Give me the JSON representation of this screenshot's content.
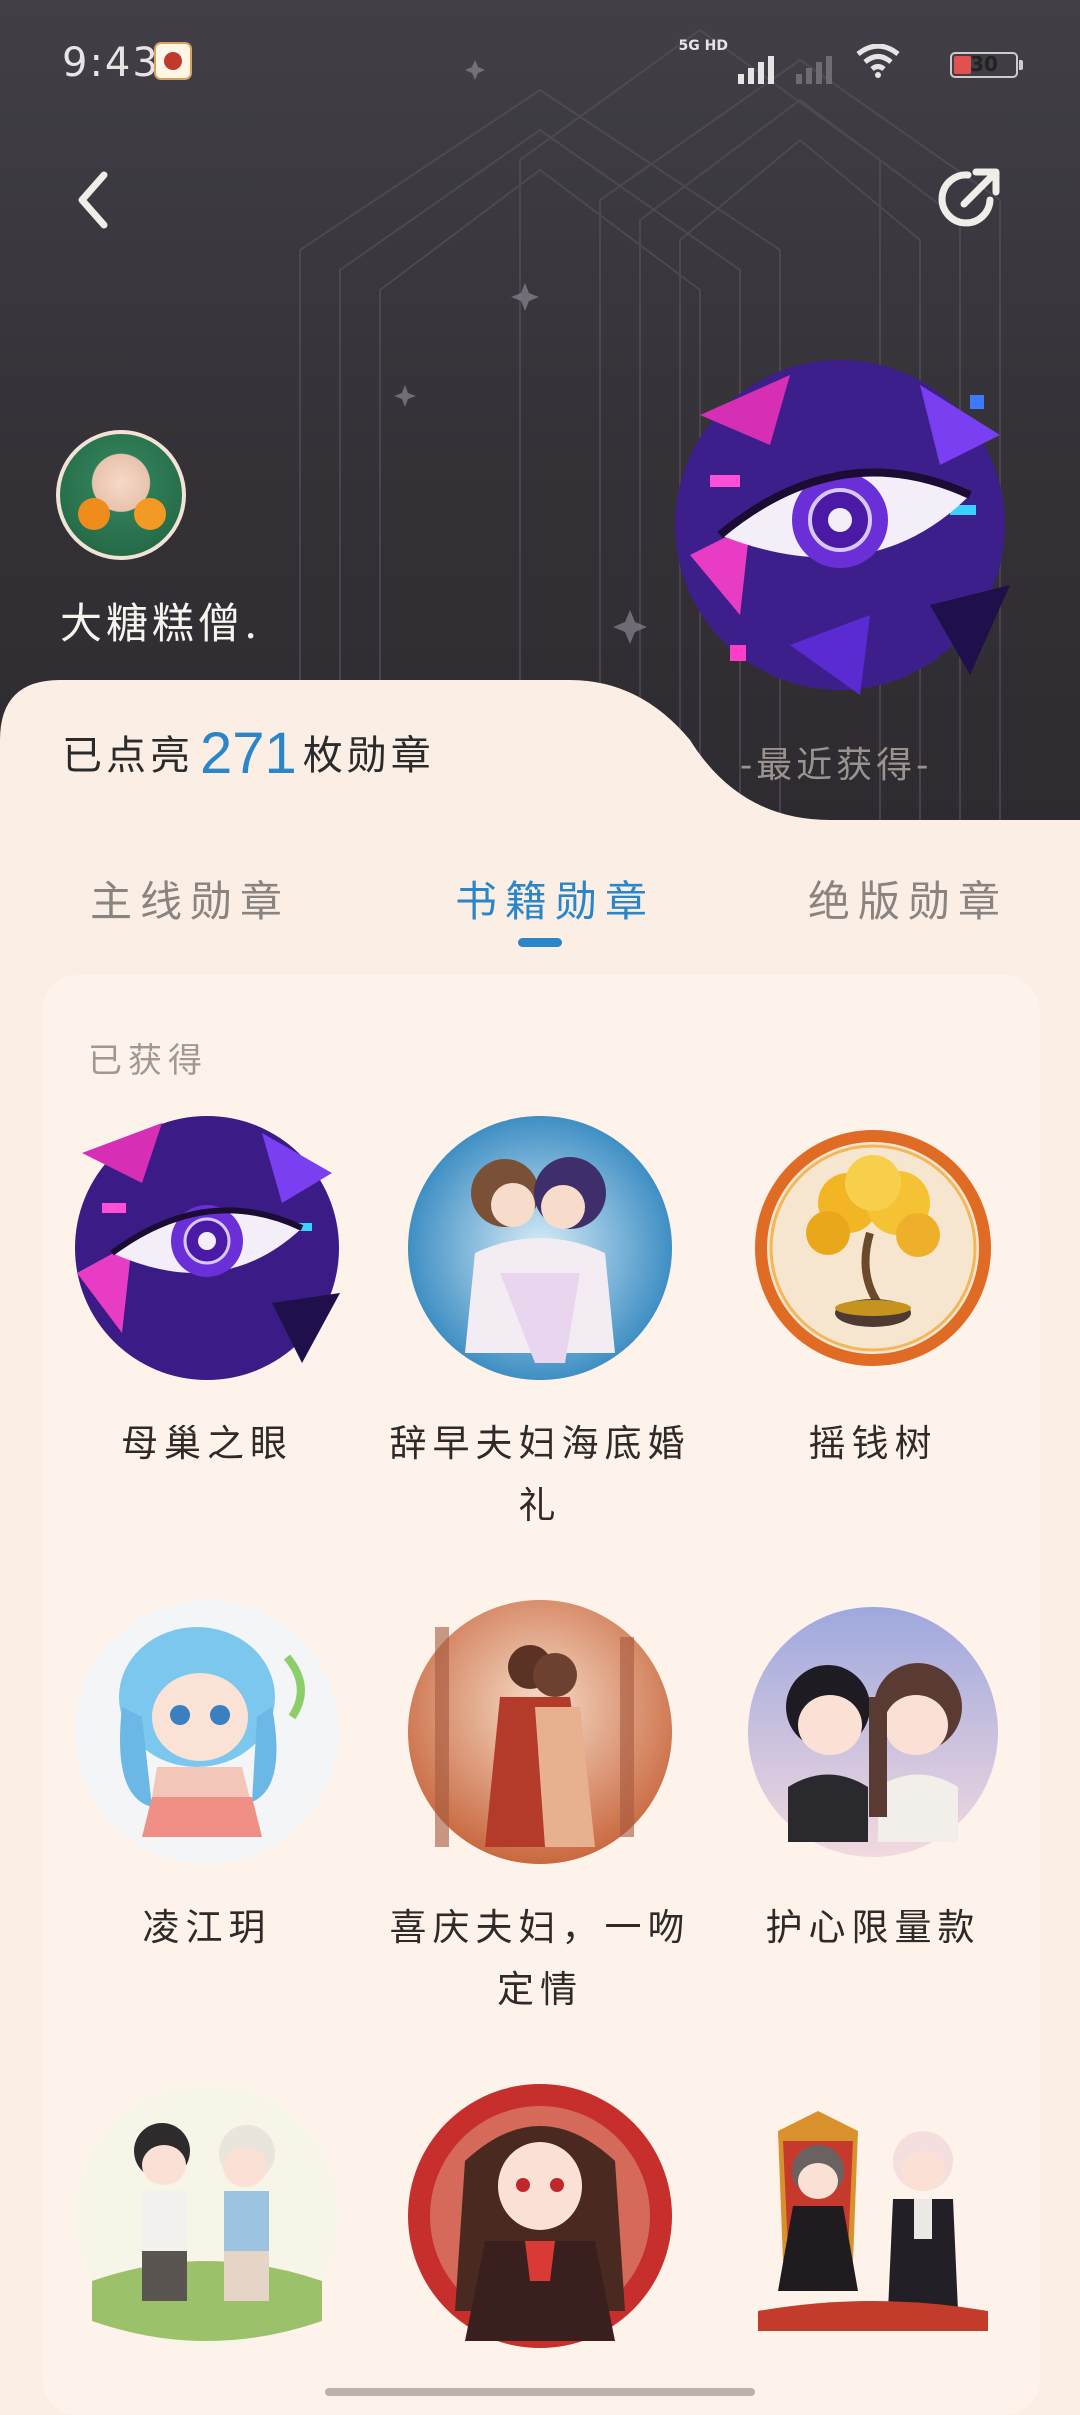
{
  "status_bar": {
    "time": "9:43",
    "network": "5G HD",
    "battery": "30"
  },
  "header": {
    "username": "大糖糕僧.",
    "recent_label": "-最近获得-"
  },
  "summary": {
    "prefix": "已点亮",
    "count": "271",
    "suffix": "枚勋章"
  },
  "tabs": [
    {
      "label": "主线勋章",
      "active": false
    },
    {
      "label": "书籍勋章",
      "active": true
    },
    {
      "label": "绝版勋章",
      "active": false
    }
  ],
  "section_title": "已获得",
  "badges": [
    {
      "name": "母巢之眼"
    },
    {
      "name": "辞早夫妇海底婚礼"
    },
    {
      "name": "摇钱树"
    },
    {
      "name": "凌江玥"
    },
    {
      "name": "喜庆夫妇，一吻定情"
    },
    {
      "name": "护心限量款"
    },
    {
      "name": ""
    },
    {
      "name": ""
    },
    {
      "name": ""
    }
  ],
  "colors": {
    "accent": "#2a86c8",
    "header_bg": "#343137",
    "page_bg": "#fbeee4"
  }
}
